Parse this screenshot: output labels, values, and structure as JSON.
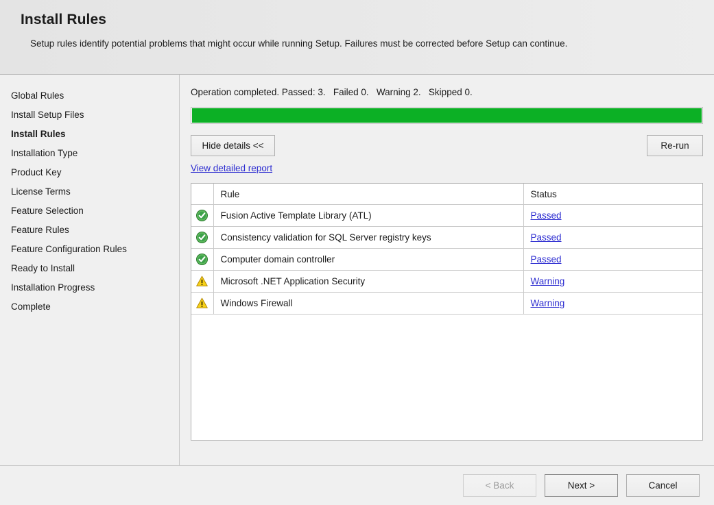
{
  "header": {
    "title": "Install Rules",
    "description": "Setup rules identify potential problems that might occur while running Setup. Failures must be corrected before Setup can continue."
  },
  "sidebar": {
    "items": [
      {
        "label": "Global Rules",
        "active": false
      },
      {
        "label": "Install Setup Files",
        "active": false
      },
      {
        "label": "Install Rules",
        "active": true
      },
      {
        "label": "Installation Type",
        "active": false
      },
      {
        "label": "Product Key",
        "active": false
      },
      {
        "label": "License Terms",
        "active": false
      },
      {
        "label": "Feature Selection",
        "active": false
      },
      {
        "label": "Feature Rules",
        "active": false
      },
      {
        "label": "Feature Configuration Rules",
        "active": false
      },
      {
        "label": "Ready to Install",
        "active": false
      },
      {
        "label": "Installation Progress",
        "active": false
      },
      {
        "label": "Complete",
        "active": false
      }
    ]
  },
  "content": {
    "summary": "Operation completed. Passed: 3.   Failed 0.   Warning 2.   Skipped 0.",
    "progress": {
      "percent": 100,
      "color": "#0cb025"
    },
    "hide_details_label": "Hide details <<",
    "rerun_label": "Re-run",
    "detailed_report_label": "View detailed report",
    "table": {
      "columns": [
        "",
        "Rule",
        "Status"
      ],
      "rows": [
        {
          "icon": "success-icon",
          "rule": "Fusion Active Template Library (ATL)",
          "status": "Passed"
        },
        {
          "icon": "success-icon",
          "rule": "Consistency validation for SQL Server registry keys",
          "status": "Passed"
        },
        {
          "icon": "success-icon",
          "rule": "Computer domain controller",
          "status": "Passed"
        },
        {
          "icon": "warning-icon",
          "rule": "Microsoft .NET Application Security",
          "status": "Warning"
        },
        {
          "icon": "warning-icon",
          "rule": "Windows Firewall",
          "status": "Warning"
        }
      ]
    }
  },
  "footer": {
    "back_label": "< Back",
    "next_label": "Next >",
    "cancel_label": "Cancel"
  },
  "colors": {
    "link": "#2b2bd0",
    "success": "#32a341",
    "warning": "#f5cb13",
    "progress": "#0cb025"
  }
}
